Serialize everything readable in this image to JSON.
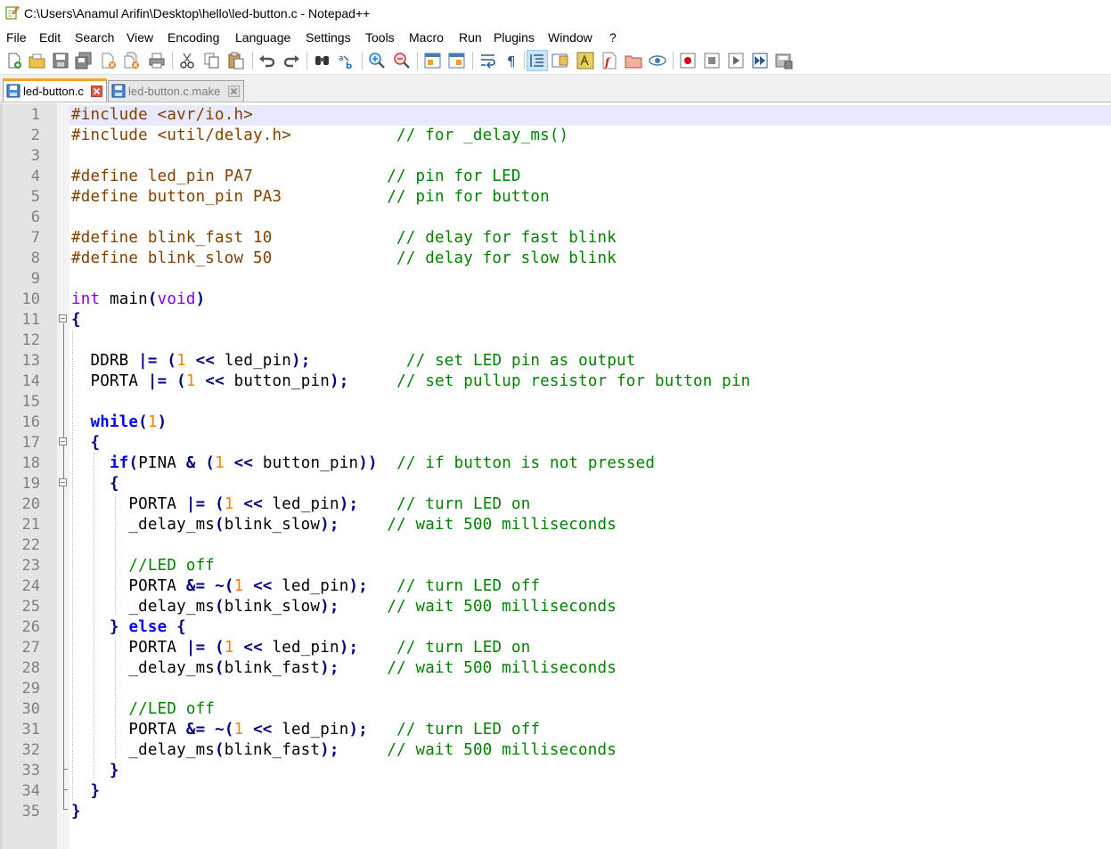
{
  "window": {
    "title": "C:\\Users\\Anamul Arifin\\Desktop\\hello\\led-button.c - Notepad++"
  },
  "menu": [
    "File",
    "Edit",
    "Search",
    "View",
    "Encoding",
    "Language",
    "Settings",
    "Tools",
    "Macro",
    "Run",
    "Plugins",
    "Window",
    "?"
  ],
  "toolbar": {
    "buttons": [
      "new-file",
      "open-file",
      "save",
      "save-all",
      "close",
      "close-all",
      "print",
      "cut",
      "copy",
      "paste",
      "undo",
      "redo",
      "find",
      "replace",
      "zoom-in",
      "zoom-out",
      "sync-vertical",
      "sync-horizontal",
      "word-wrap",
      "show-all-characters",
      "indent-guide",
      "document-map",
      "function-list",
      "user-language",
      "folder-as-workspace",
      "monitoring",
      "record-macro",
      "stop-recording",
      "play-macro",
      "run-macro-multiple",
      "save-macro"
    ]
  },
  "tabs": [
    {
      "label": "led-button.c",
      "active": true
    },
    {
      "label": "led-button.c.make",
      "active": false
    }
  ],
  "colors": {
    "preprocessor": "#804000",
    "comment": "#008000",
    "keyword": "#0000ff",
    "type": "#8000ff",
    "number": "#ff8000",
    "operator": "#000080",
    "current_line": "#e8e8ff",
    "active_tab_accent": "#f6a623"
  },
  "editor": {
    "line_numbers": [
      "1",
      "2",
      "3",
      "4",
      "5",
      "6",
      "7",
      "8",
      "9",
      "10",
      "11",
      "12",
      "13",
      "14",
      "15",
      "16",
      "17",
      "18",
      "19",
      "20",
      "21",
      "22",
      "23",
      "24",
      "25",
      "26",
      "27",
      "28",
      "29",
      "30",
      "31",
      "32",
      "33",
      "34",
      "35"
    ],
    "lines": [
      [
        [
          "pre",
          "#include <avr/io.h>"
        ]
      ],
      [
        [
          "pre",
          "#include <util/delay.h>"
        ],
        [
          "id",
          "           "
        ],
        [
          "cmt",
          "// for _delay_ms()"
        ]
      ],
      [],
      [
        [
          "pre",
          "#define led_pin PA7"
        ],
        [
          "id",
          "              "
        ],
        [
          "cmt",
          "// pin for LED"
        ]
      ],
      [
        [
          "pre",
          "#define button_pin PA3"
        ],
        [
          "id",
          "           "
        ],
        [
          "cmt",
          "// pin for button"
        ]
      ],
      [],
      [
        [
          "pre",
          "#define blink_fast 10"
        ],
        [
          "id",
          "             "
        ],
        [
          "cmt",
          "// delay for fast blink"
        ]
      ],
      [
        [
          "pre",
          "#define blink_slow 50"
        ],
        [
          "id",
          "             "
        ],
        [
          "cmt",
          "// delay for slow blink"
        ]
      ],
      [],
      [
        [
          "type",
          "int"
        ],
        [
          "id",
          " main"
        ],
        [
          "op",
          "("
        ],
        [
          "type",
          "void"
        ],
        [
          "op",
          ")"
        ]
      ],
      [
        [
          "op",
          "{"
        ]
      ],
      [],
      [
        [
          "id",
          "  DDRB "
        ],
        [
          "op",
          "|="
        ],
        [
          "id",
          " "
        ],
        [
          "op",
          "("
        ],
        [
          "num",
          "1"
        ],
        [
          "id",
          " "
        ],
        [
          "op",
          "<<"
        ],
        [
          "id",
          " led_pin"
        ],
        [
          "op",
          ");"
        ],
        [
          "id",
          "          "
        ],
        [
          "cmt",
          "// set LED pin as output"
        ]
      ],
      [
        [
          "id",
          "  PORTA "
        ],
        [
          "op",
          "|="
        ],
        [
          "id",
          " "
        ],
        [
          "op",
          "("
        ],
        [
          "num",
          "1"
        ],
        [
          "id",
          " "
        ],
        [
          "op",
          "<<"
        ],
        [
          "id",
          " button_pin"
        ],
        [
          "op",
          ");"
        ],
        [
          "id",
          "     "
        ],
        [
          "cmt",
          "// set pullup resistor for button pin"
        ]
      ],
      [],
      [
        [
          "id",
          "  "
        ],
        [
          "kw",
          "while"
        ],
        [
          "op",
          "("
        ],
        [
          "num",
          "1"
        ],
        [
          "op",
          ")"
        ]
      ],
      [
        [
          "id",
          "  "
        ],
        [
          "op",
          "{"
        ]
      ],
      [
        [
          "id",
          "    "
        ],
        [
          "kw",
          "if"
        ],
        [
          "op",
          "("
        ],
        [
          "id",
          "PINA "
        ],
        [
          "op",
          "&"
        ],
        [
          "id",
          " "
        ],
        [
          "op",
          "("
        ],
        [
          "num",
          "1"
        ],
        [
          "id",
          " "
        ],
        [
          "op",
          "<<"
        ],
        [
          "id",
          " button_pin"
        ],
        [
          "op",
          "))"
        ],
        [
          "id",
          "  "
        ],
        [
          "cmt",
          "// if button is not pressed"
        ]
      ],
      [
        [
          "id",
          "    "
        ],
        [
          "op",
          "{"
        ]
      ],
      [
        [
          "id",
          "      PORTA "
        ],
        [
          "op",
          "|="
        ],
        [
          "id",
          " "
        ],
        [
          "op",
          "("
        ],
        [
          "num",
          "1"
        ],
        [
          "id",
          " "
        ],
        [
          "op",
          "<<"
        ],
        [
          "id",
          " led_pin"
        ],
        [
          "op",
          ");"
        ],
        [
          "id",
          "    "
        ],
        [
          "cmt",
          "// turn LED on"
        ]
      ],
      [
        [
          "id",
          "      _delay_ms"
        ],
        [
          "op",
          "("
        ],
        [
          "id",
          "blink_slow"
        ],
        [
          "op",
          ");"
        ],
        [
          "id",
          "     "
        ],
        [
          "cmt",
          "// wait 500 milliseconds"
        ]
      ],
      [],
      [
        [
          "id",
          "      "
        ],
        [
          "cmt",
          "//LED off"
        ]
      ],
      [
        [
          "id",
          "      PORTA "
        ],
        [
          "op",
          "&="
        ],
        [
          "id",
          " "
        ],
        [
          "op",
          "~("
        ],
        [
          "num",
          "1"
        ],
        [
          "id",
          " "
        ],
        [
          "op",
          "<<"
        ],
        [
          "id",
          " led_pin"
        ],
        [
          "op",
          ");"
        ],
        [
          "id",
          "   "
        ],
        [
          "cmt",
          "// turn LED off"
        ]
      ],
      [
        [
          "id",
          "      _delay_ms"
        ],
        [
          "op",
          "("
        ],
        [
          "id",
          "blink_slow"
        ],
        [
          "op",
          ");"
        ],
        [
          "id",
          "     "
        ],
        [
          "cmt",
          "// wait 500 milliseconds"
        ]
      ],
      [
        [
          "id",
          "    "
        ],
        [
          "op",
          "}"
        ],
        [
          "id",
          " "
        ],
        [
          "kw",
          "else"
        ],
        [
          "id",
          " "
        ],
        [
          "op",
          "{"
        ]
      ],
      [
        [
          "id",
          "      PORTA "
        ],
        [
          "op",
          "|="
        ],
        [
          "id",
          " "
        ],
        [
          "op",
          "("
        ],
        [
          "num",
          "1"
        ],
        [
          "id",
          " "
        ],
        [
          "op",
          "<<"
        ],
        [
          "id",
          " led_pin"
        ],
        [
          "op",
          ");"
        ],
        [
          "id",
          "    "
        ],
        [
          "cmt",
          "// turn LED on"
        ]
      ],
      [
        [
          "id",
          "      _delay_ms"
        ],
        [
          "op",
          "("
        ],
        [
          "id",
          "blink_fast"
        ],
        [
          "op",
          ");"
        ],
        [
          "id",
          "     "
        ],
        [
          "cmt",
          "// wait 500 milliseconds"
        ]
      ],
      [],
      [
        [
          "id",
          "      "
        ],
        [
          "cmt",
          "//LED off"
        ]
      ],
      [
        [
          "id",
          "      PORTA "
        ],
        [
          "op",
          "&="
        ],
        [
          "id",
          " "
        ],
        [
          "op",
          "~("
        ],
        [
          "num",
          "1"
        ],
        [
          "id",
          " "
        ],
        [
          "op",
          "<<"
        ],
        [
          "id",
          " led_pin"
        ],
        [
          "op",
          ");"
        ],
        [
          "id",
          "   "
        ],
        [
          "cmt",
          "// turn LED off"
        ]
      ],
      [
        [
          "id",
          "      _delay_ms"
        ],
        [
          "op",
          "("
        ],
        [
          "id",
          "blink_fast"
        ],
        [
          "op",
          ");"
        ],
        [
          "id",
          "     "
        ],
        [
          "cmt",
          "// wait 500 milliseconds"
        ]
      ],
      [
        [
          "id",
          "    "
        ],
        [
          "op",
          "}"
        ]
      ],
      [
        [
          "id",
          "  "
        ],
        [
          "op",
          "}"
        ]
      ],
      [
        [
          "op",
          "}"
        ]
      ]
    ]
  }
}
